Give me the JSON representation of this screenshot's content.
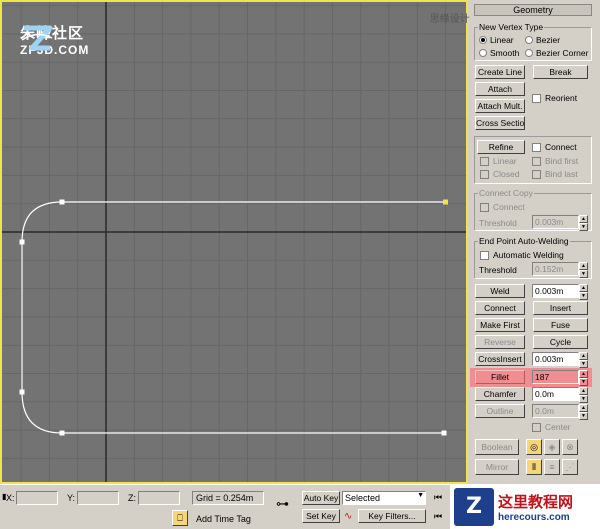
{
  "branding": {
    "logo_cn": "朱峰社区",
    "logo_en": "ZF3D.COM",
    "watermark_top": "思缘设计论坛 www.missyuan.com",
    "bottom_logo_cn": "这里教程网",
    "bottom_logo_en": "herecours.com"
  },
  "colors": {
    "viewport_bg": "#737373",
    "viewport_border": "#f2e34d",
    "grid_line": "#666666",
    "axis_line": "#2a2a2a",
    "spline": "#ffffff",
    "fillet_highlight": "#ef8d91"
  },
  "rollout": {
    "title": "Geometry"
  },
  "new_vertex_type": {
    "label": "New Vertex Type",
    "linear": "Linear",
    "bezier": "Bezier",
    "smooth": "Smooth",
    "bezier_corner": "Bezier Corner",
    "selected": "Linear"
  },
  "buttons": {
    "create_line": "Create Line",
    "break": "Break",
    "attach": "Attach",
    "reorient": "Reorient",
    "attach_mult": "Attach Mult.",
    "cross_section": "Cross Section",
    "refine": "Refine",
    "connect": "Connect",
    "linear": "Linear",
    "bind_first": "Bind first",
    "closed": "Closed",
    "bind_last": "Bind last",
    "weld": "Weld",
    "connect_btn": "Connect",
    "insert": "Insert",
    "make_first": "Make First",
    "fuse": "Fuse",
    "reverse": "Reverse",
    "cycle": "Cycle",
    "crossinsert": "CrossInsert",
    "fillet": "Fillet",
    "chamfer": "Chamfer",
    "outline": "Outline",
    "center": "Center",
    "boolean": "Boolean",
    "mirror": "Mirror"
  },
  "connect_copy": {
    "label": "Connect Copy",
    "connect": "Connect",
    "threshold_label": "Threshold",
    "threshold_value": "0.003m"
  },
  "auto_weld": {
    "label": "End Point Auto-Welding",
    "automatic": "Automatic Welding",
    "threshold_label": "Threshold",
    "threshold_value": "0.152m"
  },
  "spinners": {
    "weld": "0.003m",
    "crossinsert": "0.003m",
    "fillet": "187",
    "chamfer": "0.0m",
    "outline": "0.0m"
  },
  "statusbar": {
    "x_label": "X:",
    "y_label": "Y:",
    "z_label": "Z:",
    "grid": "Grid = 0.254m",
    "auto_key": "Auto Key",
    "set_key": "Set Key",
    "selected": "Selected",
    "add_time_tag": "Add Time Tag",
    "key_filters": "Key Filters..."
  }
}
